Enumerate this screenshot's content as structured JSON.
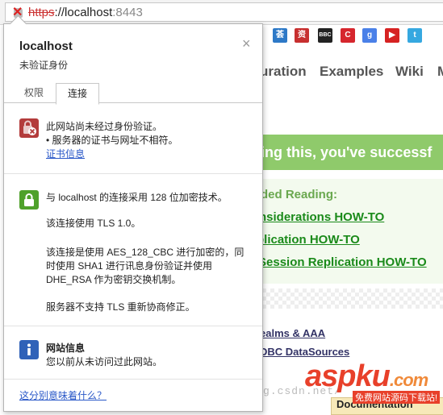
{
  "address": {
    "scheme": "https",
    "host_sep": "://localhost",
    "port": ":8443"
  },
  "bookmarks": [
    {
      "name": "translate-bookmark-icon",
      "color": "#2d79c7",
      "glyph": "荟"
    },
    {
      "name": "news-bookmark-icon",
      "color": "#c72f2f",
      "glyph": "资"
    },
    {
      "name": "bbc-bookmark-icon",
      "color": "#222222",
      "glyph": "BBC"
    },
    {
      "name": "red-c-bookmark-icon",
      "color": "#d6262d",
      "glyph": "C"
    },
    {
      "name": "google-bookmark-icon",
      "color": "#4a80e8",
      "glyph": "g"
    },
    {
      "name": "youtube-bookmark-icon",
      "color": "#d62222",
      "glyph": "▶"
    },
    {
      "name": "twitter-bookmark-icon",
      "color": "#36a8e0",
      "glyph": "t"
    },
    {
      "name": "globe-bookmark-icon",
      "color": "#3b88d6",
      "glyph": "◍"
    },
    {
      "name": "green-s-bookmark-icon",
      "color": "#5a9e2c",
      "glyph": "$"
    }
  ],
  "page": {
    "nav": [
      "uration",
      "Examples",
      "Wiki",
      "M"
    ],
    "banner": "ing this, you've successf",
    "recommended_heading": "ded Reading:",
    "rec_links": [
      "nsiderations HOW-TO",
      "plication HOW-TO",
      "Session Replication HOW-TO"
    ],
    "doc_links": [
      "ealms & AAA",
      "DBC DataSources"
    ],
    "documentation_tab": "Documentation",
    "watermark_url": "http://blog.csdn.net/",
    "logo_asp": "asp",
    "logo_ku": "ku",
    "logo_com": ".com",
    "logo_sub": "免费网站源码下载站!"
  },
  "popup": {
    "title": "localhost",
    "subtitle": "未验证身份",
    "close": "×",
    "tabs": [
      "权限",
      "连接"
    ],
    "identity": {
      "line1": "此网站尚未经过身份验证。",
      "line2": "• 服务器的证书与网址不相符。",
      "cert_link": "证书信息"
    },
    "connection": {
      "line1": "与 localhost 的连接采用 128 位加密技术。",
      "line2": "该连接使用 TLS 1.0。",
      "line3": "该连接是使用 AES_128_CBC 进行加密的，同",
      "line4": "时使用 SHA1 进行讯息身份验证并使用",
      "line5": "DHE_RSA 作为密钥交换机制。",
      "line6": "服务器不支持 TLS 重新协商修正。"
    },
    "site_info": {
      "title": "网站信息",
      "body": "您以前从未访问过此网站。"
    },
    "help_link": "这分别意味着什么？"
  }
}
